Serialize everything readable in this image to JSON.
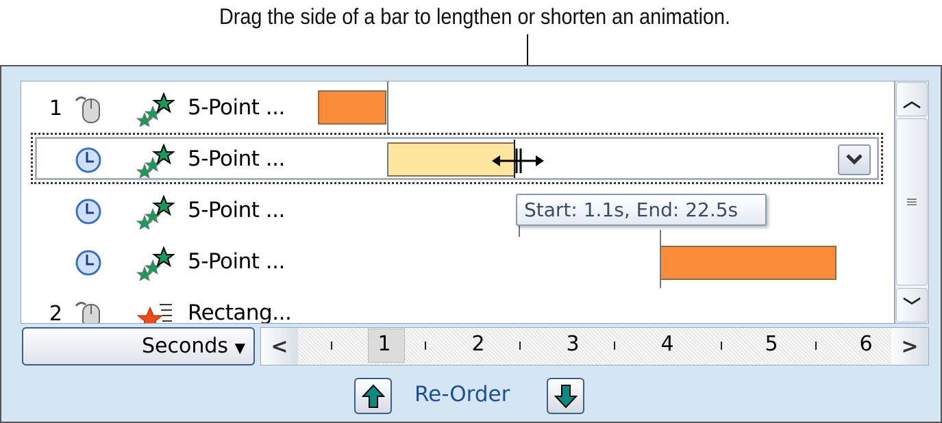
{
  "caption": "Drag the side of a bar to lengthen or shorten an animation.",
  "rows": [
    {
      "number": "1",
      "trigger": "mouse-click-icon",
      "effect": "stars-effect-icon",
      "label": "5-Point ...",
      "bar_color": "#fa8c3c"
    },
    {
      "number": "",
      "trigger": "clock-icon",
      "effect": "stars-effect-icon",
      "label": "5-Point ...",
      "bar_color": "#fde6a0",
      "selected": true
    },
    {
      "number": "",
      "trigger": "clock-icon",
      "effect": "stars-effect-icon",
      "label": "5-Point ..."
    },
    {
      "number": "",
      "trigger": "clock-icon",
      "effect": "stars-effect-icon",
      "label": "5-Point ...",
      "bar_color": "#fa8c3c"
    },
    {
      "number": "2",
      "trigger": "mouse-click-icon",
      "effect": "rectangle-effect-icon",
      "label": "Rectang..."
    }
  ],
  "tooltip": "Start: 1.1s, End: 22.5s",
  "timeline": {
    "unit_label": "Seconds",
    "ticks": [
      "1",
      "2",
      "3",
      "4",
      "5",
      "6"
    ],
    "highlighted": "1"
  },
  "reorder_label": "Re-Order"
}
